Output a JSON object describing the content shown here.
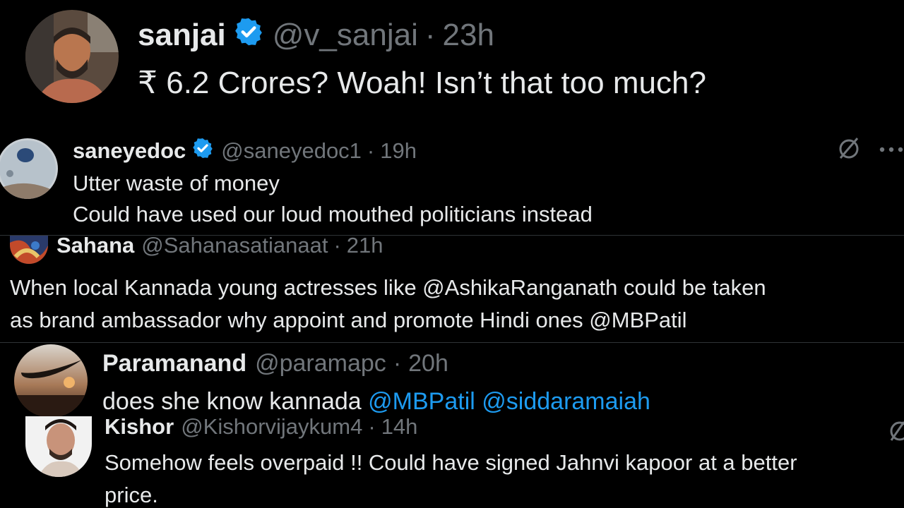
{
  "tweets": [
    {
      "name": "sanjai",
      "verified": true,
      "handle": "@v_sanjai",
      "time": "23h",
      "lines": [
        "₹ 6.2 Crores? Woah! Isn’t that too much?"
      ]
    },
    {
      "name": "saneyedoc",
      "verified": true,
      "handle": "@saneyedoc1",
      "time": "19h",
      "lines": [
        "Utter waste of money",
        "Could have used our loud mouthed politicians instead"
      ],
      "icons": [
        "grok-slash-icon",
        "more-icon"
      ]
    },
    {
      "name": "Sahana",
      "handle": "@Sahanasatianaat",
      "time": "21h",
      "lines": [
        "When local Kannada young actresses like @AshikaRanganath could be taken",
        "as brand ambassador why appoint and promote Hindi ones @MBPatil"
      ]
    },
    {
      "name": "Paramanand",
      "handle": "@paramapc",
      "time": "20h",
      "text_plain": "does she know kannada ",
      "mentions": [
        "@MBPatil",
        "@siddaramaiah"
      ]
    },
    {
      "name": "Kishor",
      "handle": "@Kishorvijaykum4",
      "time": "14h",
      "lines": [
        "Somehow feels overpaid !! Could have signed Jahnvi kapoor at a better",
        "price."
      ]
    }
  ],
  "separator": "·",
  "colors": {
    "background": "#000000",
    "text": "#e7e9ea",
    "muted": "#71767b",
    "link": "#1d9bf0",
    "verified": "#1d9bf0"
  }
}
